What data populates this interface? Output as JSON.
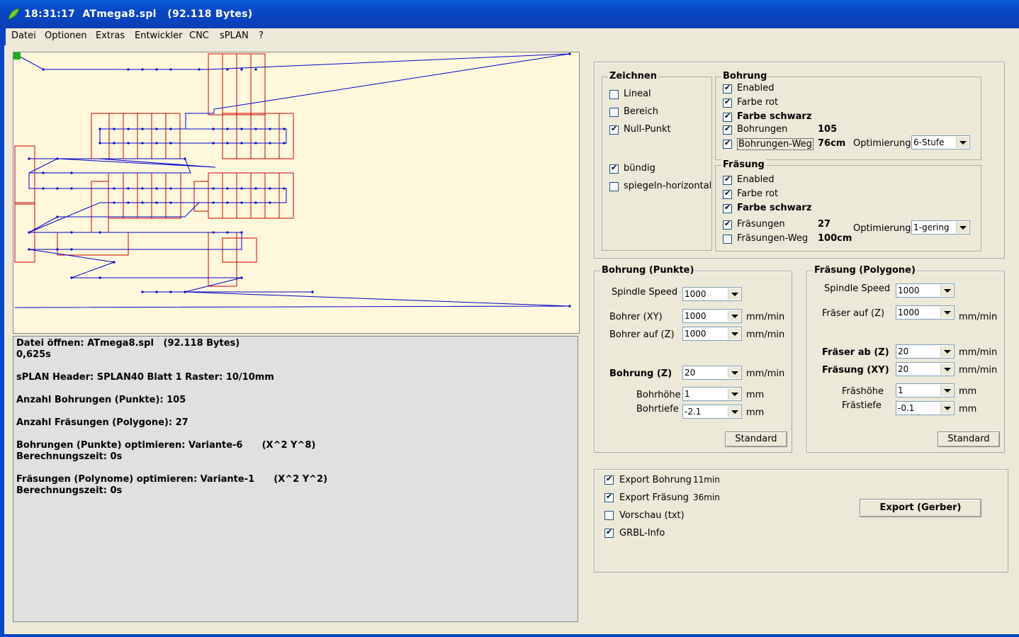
{
  "window": {
    "title": "18:31:17  ATmega8.spl   (92.118 Bytes)"
  },
  "menu": [
    "Datei",
    "Optionen",
    "Extras",
    "Entwickler",
    "CNC",
    "sPLAN",
    "?"
  ],
  "log": [
    "Datei öffnen: ATmega8.spl   (92.118 Bytes)",
    "0,625s",
    "sPLAN Header: SPLAN40 Blatt 1 Raster: 10/10mm",
    "Anzahl Bohrungen (Punkte): 105",
    "Anzahl Fräsungen (Polygone): 27",
    "Bohrungen (Punkte) optimieren: Variante-6      (X^2 Y^8)",
    "Berechnungszeit: 0s",
    "Fräsungen (Polynome) optimieren: Variante-1      (X^2 Y^2)",
    "Berechnungszeit: 0s"
  ],
  "zeichnen": {
    "title": "Zeichnen",
    "lineal": "Lineal",
    "bereich": "Bereich",
    "null_punkt": "Null-Punkt",
    "buendig": "bündig",
    "spiegeln": "spiegeln-horizontal"
  },
  "bohrung": {
    "title": "Bohrung",
    "enabled": "Enabled",
    "farbe_rot": "Farbe rot",
    "farbe_schwarz": "Farbe schwarz",
    "bohrungen": "Bohrungen",
    "bohrungen_count": "105",
    "weg": "Bohrungen-Weg",
    "weg_value": "76cm",
    "optimierung": "Optimierung",
    "optimierung_value": "6-Stufe"
  },
  "fraesung": {
    "title": "Fräsung",
    "enabled": "Enabled",
    "farbe_rot": "Farbe rot",
    "farbe_schwarz": "Farbe schwarz",
    "fraesungen": "Fräsungen",
    "fraesungen_count": "27",
    "weg": "Fräsungen-Weg",
    "weg_value": "100cm",
    "optimierung": "Optimierung",
    "optimierung_value": "1-gering"
  },
  "bohrung_punkte": {
    "title": "Bohrung (Punkte)",
    "spindle_speed": "Spindle Speed",
    "spindle_value": "1000",
    "bohrer_xy": "Bohrer (XY)",
    "bohrer_xy_value": "1000",
    "bohrer_z": "Bohrer auf (Z)",
    "bohrer_z_value": "1000",
    "bohrung_z": "Bohrung (Z)",
    "bohrung_z_value": "20",
    "bohrhoehe": "Bohrhöhe",
    "bohrhoehe_value": "1",
    "bohrtiefe": "Bohrtiefe",
    "bohrtiefe_value": "-2.1",
    "unit_mmmin": "mm/min",
    "unit_mm": "mm",
    "standard": "Standard"
  },
  "fraesung_polygone": {
    "title": "Fräsung (Polygone)",
    "spindle_speed": "Spindle Speed",
    "spindle_value": "1000",
    "fraeser_auf": "Fräser auf (Z)",
    "fraeser_auf_value": "1000",
    "fraeser_ab": "Fräser ab (Z)",
    "fraeser_ab_value": "20",
    "fraesung_xy": "Fräsung (XY)",
    "fraesung_xy_value": "20",
    "fraeshoehe": "Fräshöhe",
    "fraeshoehe_value": "1",
    "fraestiefe": "Frästiefe",
    "fraestiefe_value": "-0.1",
    "unit_mmmin": "mm/min",
    "unit_mm": "mm",
    "standard": "Standard"
  },
  "export": {
    "bohrung": "Export Bohrung",
    "bohrung_time": "11min",
    "fraesung": "Export Fräsung",
    "fraesung_time": "36min",
    "vorschau": "Vorschau (txt)",
    "grbl": "GRBL-Info",
    "button": "Export (Gerber)"
  },
  "colors": {
    "title_bar": "#0846c4",
    "canvas": "#FFF8DC",
    "milling": "#cc0000",
    "drill_path": "#0000cc"
  }
}
